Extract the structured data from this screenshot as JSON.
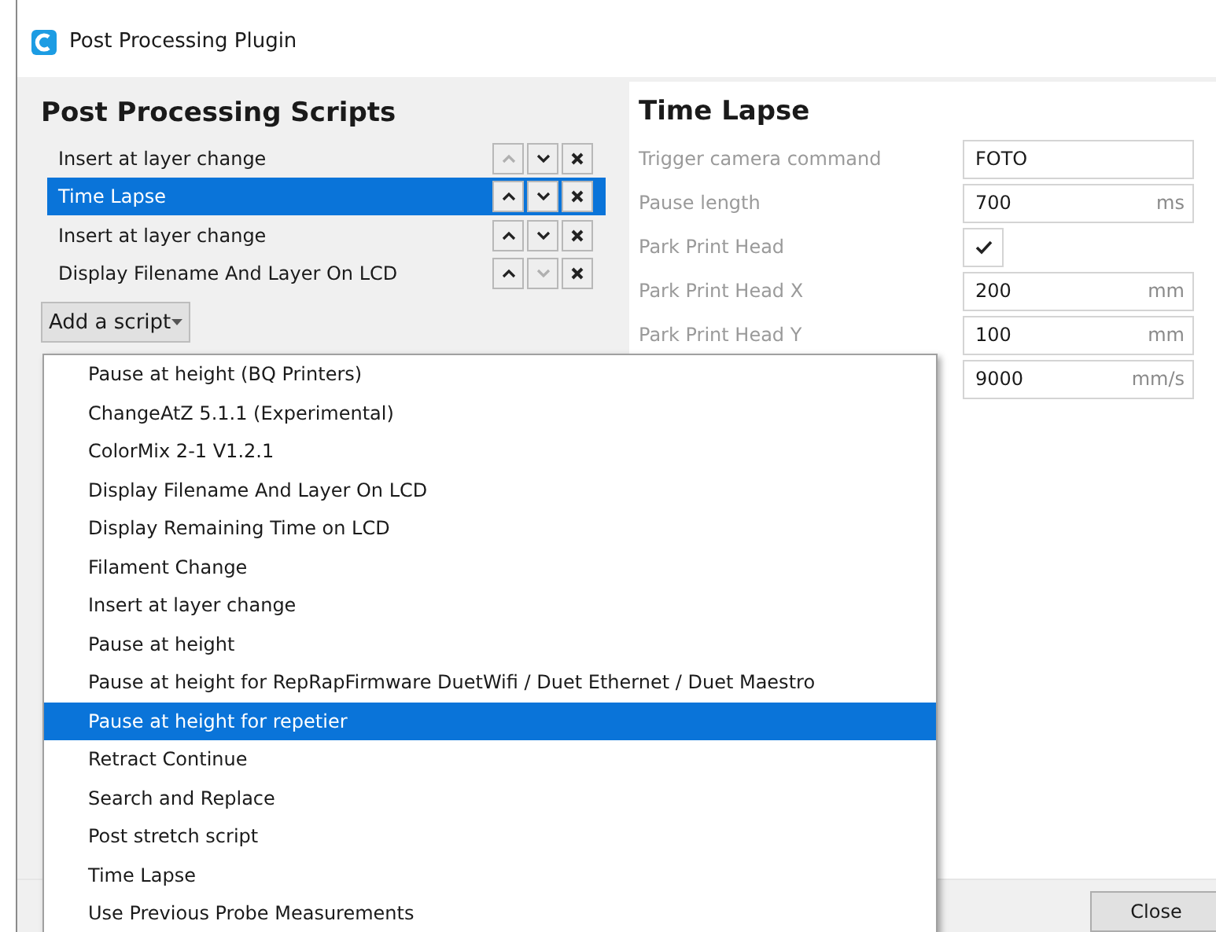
{
  "window": {
    "title": "Post Processing Plugin"
  },
  "scripts_panel": {
    "heading": "Post Processing Scripts",
    "scripts": [
      {
        "name": "Insert at layer change",
        "selected": false,
        "up_disabled": true,
        "down_disabled": false
      },
      {
        "name": "Time Lapse",
        "selected": true,
        "up_disabled": false,
        "down_disabled": false
      },
      {
        "name": "Insert at layer change",
        "selected": false,
        "up_disabled": false,
        "down_disabled": false
      },
      {
        "name": "Display Filename And Layer On LCD",
        "selected": false,
        "up_disabled": false,
        "down_disabled": true
      }
    ],
    "add_button": "Add a script"
  },
  "settings_panel": {
    "heading": "Time Lapse",
    "settings": [
      {
        "kind": "text",
        "label": "Trigger camera command",
        "value": "FOTO"
      },
      {
        "kind": "text",
        "label": "Pause length",
        "value": "700",
        "unit": "ms"
      },
      {
        "kind": "checkbox",
        "label": "Park Print Head",
        "checked": true
      },
      {
        "kind": "text",
        "label": "Park Print Head X",
        "value": "200",
        "unit": "mm"
      },
      {
        "kind": "text",
        "label": "Park Print Head Y",
        "value": "100",
        "unit": "mm"
      },
      {
        "kind": "text",
        "value": "9000",
        "unit": "mm/s"
      }
    ]
  },
  "script_menu": {
    "items": [
      {
        "label": "Pause at height (BQ Printers)",
        "selected": false
      },
      {
        "label": "ChangeAtZ 5.1.1 (Experimental)",
        "selected": false
      },
      {
        "label": "ColorMix 2-1 V1.2.1",
        "selected": false
      },
      {
        "label": "Display Filename And Layer On LCD",
        "selected": false
      },
      {
        "label": "Display Remaining Time on LCD",
        "selected": false
      },
      {
        "label": "Filament Change",
        "selected": false
      },
      {
        "label": "Insert at layer change",
        "selected": false
      },
      {
        "label": "Pause at height",
        "selected": false
      },
      {
        "label": "Pause at height for RepRapFirmware DuetWifi / Duet Ethernet / Duet Maestro",
        "selected": false
      },
      {
        "label": "Pause at height for repetier",
        "selected": true
      },
      {
        "label": "Retract Continue",
        "selected": false
      },
      {
        "label": "Search and Replace",
        "selected": false
      },
      {
        "label": "Post stretch script",
        "selected": false
      },
      {
        "label": "Time Lapse",
        "selected": false
      },
      {
        "label": "Use Previous Probe Measurements",
        "selected": false
      }
    ]
  },
  "footer": {
    "close_button": "Close"
  }
}
